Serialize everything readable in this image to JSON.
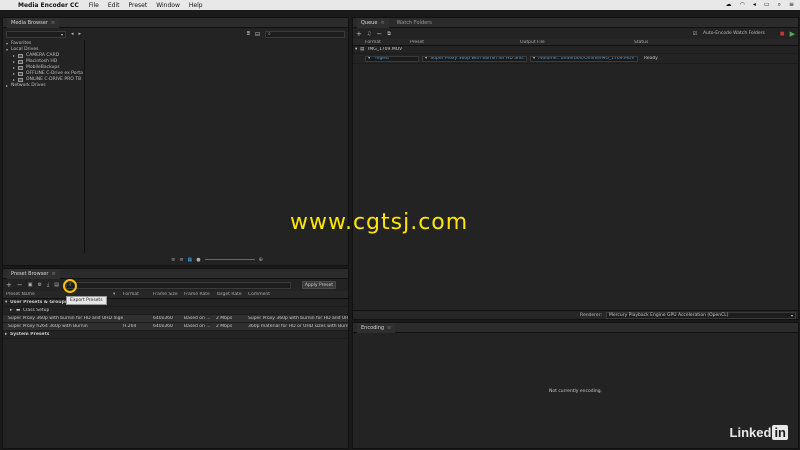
{
  "menubar": {
    "app_name": "Media Encoder CC",
    "items": [
      "File",
      "Edit",
      "Preset",
      "Window",
      "Help"
    ]
  },
  "media_browser": {
    "tab_label": "Media Browser",
    "tree": [
      {
        "label": "Favorites",
        "level": 0,
        "expanded": true,
        "drive": false
      },
      {
        "label": "Local Drives",
        "level": 0,
        "expanded": true,
        "drive": false
      },
      {
        "label": "CAMERA CARD",
        "level": 1,
        "expanded": false,
        "drive": true
      },
      {
        "label": "Macintosh HD",
        "level": 1,
        "expanded": false,
        "drive": true
      },
      {
        "label": "MobileBackups",
        "level": 1,
        "expanded": false,
        "drive": true
      },
      {
        "label": "OFFLINE C-Drive ex Porta",
        "level": 1,
        "expanded": false,
        "drive": true
      },
      {
        "label": "ONLINE C-DRIVE PRO TB",
        "level": 1,
        "expanded": false,
        "drive": true
      },
      {
        "label": "Network Drives",
        "level": 0,
        "expanded": false,
        "drive": false
      }
    ]
  },
  "preset_browser": {
    "tab_label": "Preset Browser",
    "apply_button": "Apply Preset",
    "tooltip": "Export Presets",
    "columns": [
      "Preset Name",
      "Format",
      "Frame Size",
      "Frame Rate",
      "Target Rate",
      "Comment"
    ],
    "group_user": "User Presets & Groups",
    "subgroup": "Class Setup",
    "rows": [
      {
        "name": "Super Proxy 360p with burnin for HD and UHD Ingest (H...",
        "format": "",
        "frame_size": "640x360",
        "frame_rate": "Based on ...",
        "target_rate": "2 Mbps",
        "comment": "Super Proxy 360p with burnin for HD and UHD..."
      },
      {
        "name": "Super Proxy h264 360p with Burnin",
        "format": "H.264",
        "frame_size": "640x360",
        "frame_rate": "Based on ...",
        "target_rate": "2 Mbps",
        "comment": "360p material for HD or UHD sizes with Burnin"
      }
    ],
    "group_system": "System Presets"
  },
  "queue": {
    "tabs": [
      "Queue",
      "Watch Folders"
    ],
    "auto_encode_label": "Auto-Encode Watch Folders",
    "auto_encode_checked": true,
    "columns": [
      "Format",
      "Preset",
      "Output File",
      "Status"
    ],
    "item_name": "IMG_1709.MOV",
    "row": {
      "format": "Ingest",
      "preset": "Super Proxy 360p with burnin for HD and...",
      "output": "/Volume...underbolt/Online/IMG_1709.MOV",
      "status": "Ready"
    },
    "renderer_label": "Renderer:",
    "renderer_value": "Mercury Playback Engine GPU Acceleration (OpenCL)"
  },
  "encoding": {
    "tab_label": "Encoding",
    "status_text": "Not currently encoding."
  },
  "watermark": "www.cgtsj.com",
  "brand": {
    "text": "Linked",
    "in": "in"
  },
  "colors": {
    "accent": "#4aa3e8",
    "highlight": "#f2c400",
    "watermark": "#ffe600"
  }
}
